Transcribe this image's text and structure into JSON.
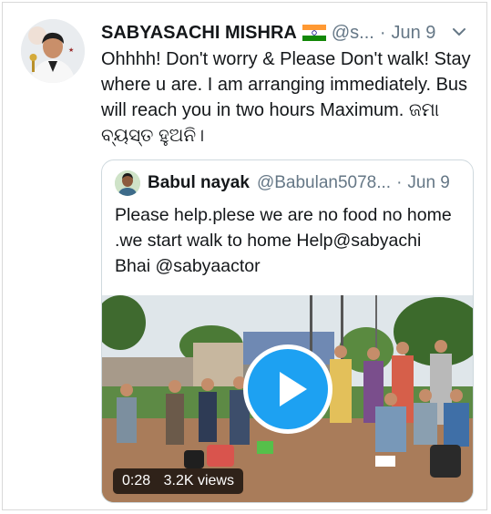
{
  "tweet": {
    "author_name": "SABYASACHI MISHRA",
    "flag_icon": "india-flag-icon",
    "handle": "@s...",
    "separator": "·",
    "date": "Jun 9",
    "text": "Ohhhh! Don't worry & Please Don't walk! Stay where u are. I am arranging immediately. Bus will reach you in two hours Maximum. ଜମା ବ୍ୟସ୍ତ ହୁଅନି।",
    "more_icon": "chevron-down-icon"
  },
  "quoted_tweet": {
    "author_name": "Babul nayak",
    "handle": "@Babulan5078...",
    "separator": "·",
    "date": "Jun 9",
    "text": "Please help.plese we are no food no home .we start walk to home Help@sabyachi Bhai @sabyaactor",
    "video": {
      "duration": "0:28",
      "views": "3.2K views",
      "play_icon": "play-icon"
    }
  },
  "colors": {
    "accent": "#1da1f2",
    "secondary_text": "#657786",
    "border": "#cfd9de"
  }
}
